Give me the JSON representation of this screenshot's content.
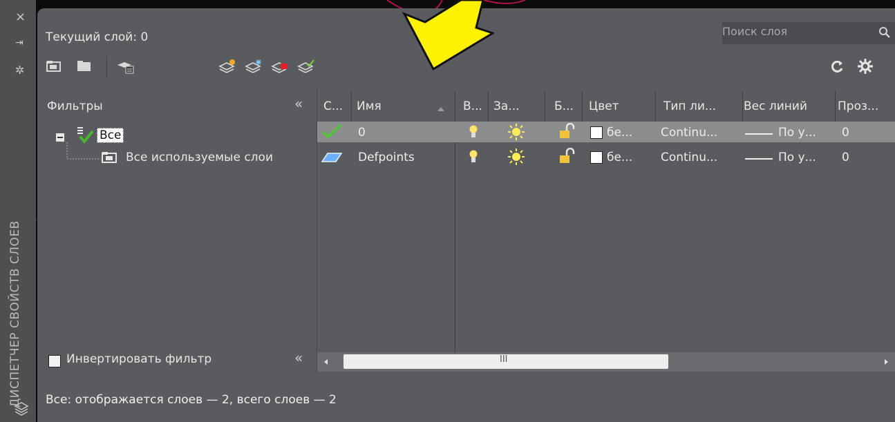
{
  "side_strip": {
    "close_glyph": "×",
    "autohide_glyph": "⇥",
    "settings_glyph": "✲",
    "vertical_title": "ДИСПЕТЧЕР СВОЙСТВ СЛОЕВ"
  },
  "header": {
    "current_layer": "Текущий слой: 0",
    "search_placeholder": "Поиск слоя"
  },
  "filters": {
    "title": "Фильтры",
    "collapse_glyph": "«",
    "tree_root": "Все",
    "tree_child": "Все используемые слои",
    "invert_label": "Инвертировать фильтр",
    "invert_collapse_glyph": "«"
  },
  "table": {
    "columns": [
      "С...",
      "Имя",
      "В...",
      "За...",
      "Б...",
      "Цвет",
      "Тип ли...",
      "Вес линий",
      "Проз..."
    ],
    "rows": [
      {
        "name": "0",
        "color": "бе...",
        "linetype": "Continu...",
        "lineweight": "По у...",
        "transparency": "0"
      },
      {
        "name": "Defpoints",
        "color": "бе...",
        "linetype": "Continu...",
        "lineweight": "По у...",
        "transparency": "0"
      }
    ],
    "scroll_thumb_glyph": "III"
  },
  "status_text": "Все: отображается слоев — 2, всего слоев — 2",
  "colors": {
    "panel_bg": "#5a5b5e",
    "arrow_yellow": "#fff200",
    "background_line": "#c2185b"
  }
}
